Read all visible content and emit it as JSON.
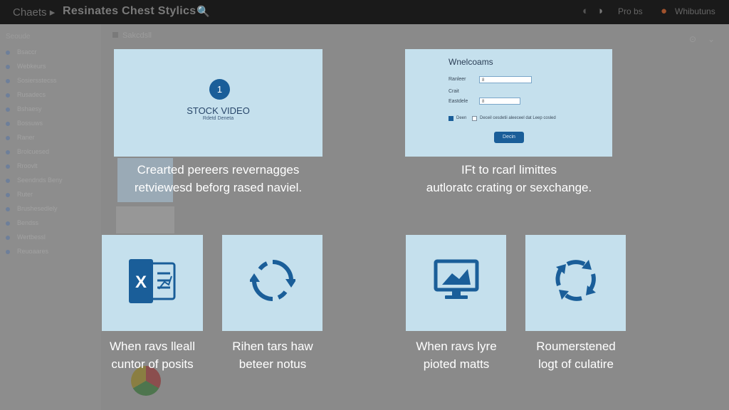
{
  "topbar": {
    "left": "Chaets ▸",
    "title": "Resinates Chest Stylics",
    "search_icon": "🔍",
    "right_icon1": "◐",
    "right_icon2": "◑",
    "right_text1": "Pro bs",
    "right_icon3": "●",
    "right_text2": "Whibutuns"
  },
  "sidebar": {
    "heading": "Seoude",
    "items": [
      "Bsaccr",
      "Webkeurs",
      "Sosiersstecss",
      "Rusadecs",
      "Bshaesy",
      "Bossuws",
      "Raner",
      "Brolcuesed",
      "Rroovlt",
      "Seendnds Beny",
      "Ruter",
      "Brushesedlely",
      "Bendss",
      "Wertbessl",
      "Reuoaares"
    ]
  },
  "main": {
    "heading": "Sakcdsll",
    "corner1": "⊙",
    "corner2": "⌄"
  },
  "card_video": {
    "badge": "1",
    "title": "STOCK VIDEO",
    "subtitle": "Rdetd Deneta"
  },
  "card_form": {
    "title": "Wnelcoams",
    "label1": "Ranleer",
    "input1": "8",
    "label2": "Crait",
    "label3": "Eastdele",
    "input2": "8",
    "check1_label": "Deen",
    "check2_label": "Deceil cesdetii aleeceel dat Leep cosled",
    "button": "Decin"
  },
  "captions": {
    "top_left": [
      "Crearted pereers revernagges",
      "retviewesd beforg rased naviel."
    ],
    "top_right": [
      "IFt to rcarl limittes",
      "autloratc crating or sexchange."
    ],
    "tile1": [
      "When ravs lleall",
      "cuntor of posits"
    ],
    "tile2": [
      "Rihen tars haw",
      "beteer notus"
    ],
    "tile3": [
      "When ravs lyre",
      "pioted matts"
    ],
    "tile4": [
      "Roumerstened",
      "logt of culatire"
    ]
  },
  "tiles": [
    {
      "icon": "excel-icon"
    },
    {
      "icon": "sync-icon"
    },
    {
      "icon": "monitor-icon"
    },
    {
      "icon": "refresh-icon"
    }
  ],
  "colors": {
    "accent": "#1a5e99",
    "card": "#c5e0ed",
    "topbar": "#1a1a1a",
    "background": "#8a8a8a"
  }
}
